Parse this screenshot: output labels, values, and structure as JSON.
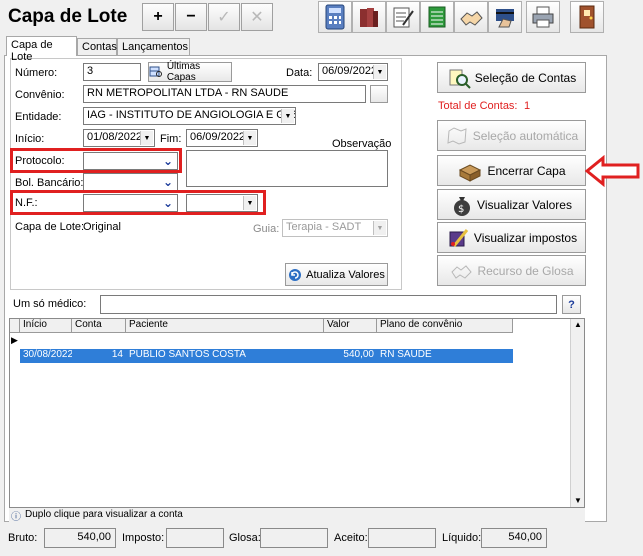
{
  "window": {
    "title": "Capa de Lote"
  },
  "toolbar": {
    "add_label": "+",
    "remove_label": "−",
    "confirm_label": "✓",
    "cancel_label": "✕"
  },
  "tabs": [
    {
      "label": "Capa de Lote"
    },
    {
      "label": "Contas"
    },
    {
      "label": "Lançamentos"
    }
  ],
  "form": {
    "numero_label": "Número:",
    "numero_value": "3",
    "ultimas_capas_label": "Últimas Capas",
    "data_label": "Data:",
    "data_value": "06/09/2022",
    "convenio_label": "Convênio:",
    "convenio_value": "RN METROPOLITAN LTDA - RN SAUDE",
    "entidade_label": "Entidade:",
    "entidade_value": "IAG - INSTITUTO DE ANGIOLOGIA E GASTI",
    "inicio_label": "Início:",
    "inicio_value": "01/08/2022",
    "fim_label": "Fim:",
    "fim_value": "06/09/2022",
    "observacao_label": "Observação",
    "protocolo_label": "Protocolo:",
    "bol_bancario_label": "Bol. Bancário:",
    "nf_label": "N.F.:",
    "capa_de_lote_label": "Capa de Lote:",
    "capa_de_lote_value": "Original",
    "guia_label": "Guia:",
    "guia_value": "Terapia - SADT",
    "atualiza_valores_label": "Atualiza Valores"
  },
  "side": {
    "selecao_contas_label": "Seleção de Contas",
    "total_contas_label": "Total de Contas:",
    "total_contas_value": "1",
    "selecao_automatica_label": "Seleção automática",
    "encerrar_capa_label": "Encerrar Capa",
    "visualizar_valores_label": "Visualizar Valores",
    "visualizar_impostos_label": "Visualizar impostos",
    "recurso_glosa_label": "Recurso de Glosa"
  },
  "medico": {
    "label": "Um só médico:",
    "help_label": "?"
  },
  "grid": {
    "columns": [
      "Início",
      "Conta",
      "Paciente",
      "Valor",
      "Plano de convênio"
    ],
    "rows": [
      {
        "inicio": "30/08/2022",
        "conta": "14",
        "paciente": "PUBLIO SANTOS COSTA",
        "valor": "540,00",
        "plano": "RN SAUDE"
      }
    ]
  },
  "hint": "Duplo clique para visualizar a conta",
  "footer": {
    "bruto_label": "Bruto:",
    "bruto_value": "540,00",
    "imposto_label": "Imposto:",
    "imposto_value": "",
    "glosa_label": "Glosa:",
    "glosa_value": "",
    "aceito_label": "Aceito:",
    "aceito_value": "",
    "liquido_label": "Líquido:",
    "liquido_value": "540,00"
  },
  "colors": {
    "selection": "#2f7ed8",
    "highlight": "#e02020",
    "total_text": "#e02020"
  }
}
